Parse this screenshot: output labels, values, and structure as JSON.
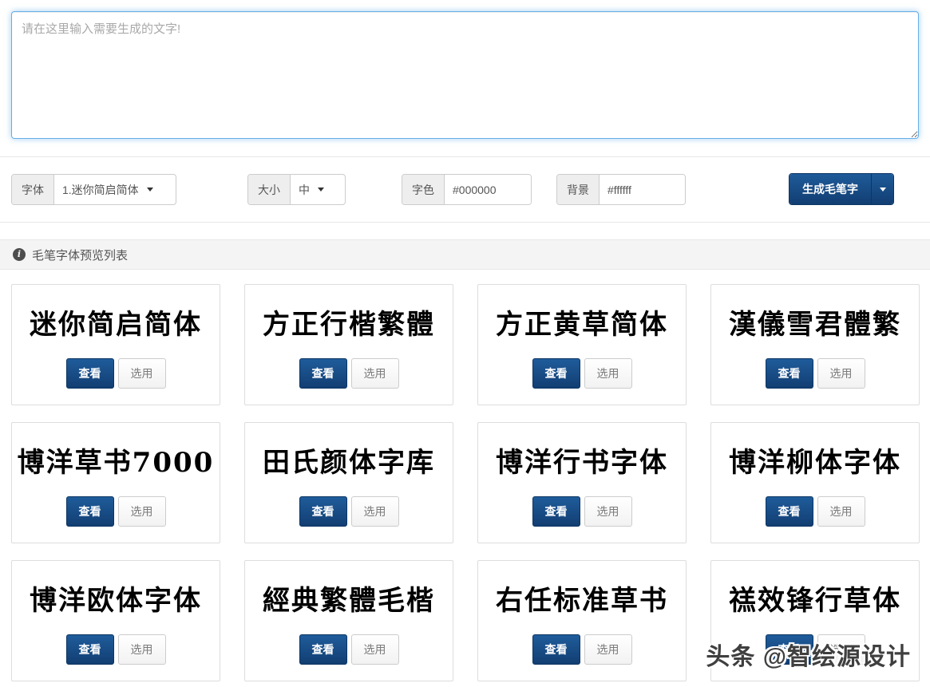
{
  "textarea": {
    "placeholder": "请在这里输入需要生成的文字!",
    "value": ""
  },
  "toolbar": {
    "font": {
      "label": "字体",
      "value": "1.迷你简启简体"
    },
    "size": {
      "label": "大小",
      "value": "中"
    },
    "font_color": {
      "label": "字色",
      "value": "#000000"
    },
    "background": {
      "label": "背景",
      "value": "#ffffff"
    },
    "generate": {
      "label": "生成毛笔字"
    }
  },
  "section": {
    "title": "毛笔字体预览列表"
  },
  "card_actions": {
    "view": "查看",
    "select": "选用"
  },
  "cards": [
    {
      "name": "迷你简启简体"
    },
    {
      "name": "方正行楷繁體"
    },
    {
      "name": "方正黄草简体"
    },
    {
      "name": "漢儀雪君體繁"
    },
    {
      "name": "博洋草书7000"
    },
    {
      "name": "田氏颜体字库"
    },
    {
      "name": "博洋行书字体"
    },
    {
      "name": "博洋柳体字体"
    },
    {
      "name": "博洋欧体字体"
    },
    {
      "name": "經典繁體毛楷"
    },
    {
      "name": "右任标准草书"
    },
    {
      "name": "禚效锋行草体"
    }
  ],
  "watermark": "头条 @智绘源设计",
  "colors": {
    "accent_navy": "#15497e",
    "textarea_focus_border": "#66afe9",
    "addon_bg": "#eeeeee",
    "section_bar_bg": "#f4f4f4"
  }
}
